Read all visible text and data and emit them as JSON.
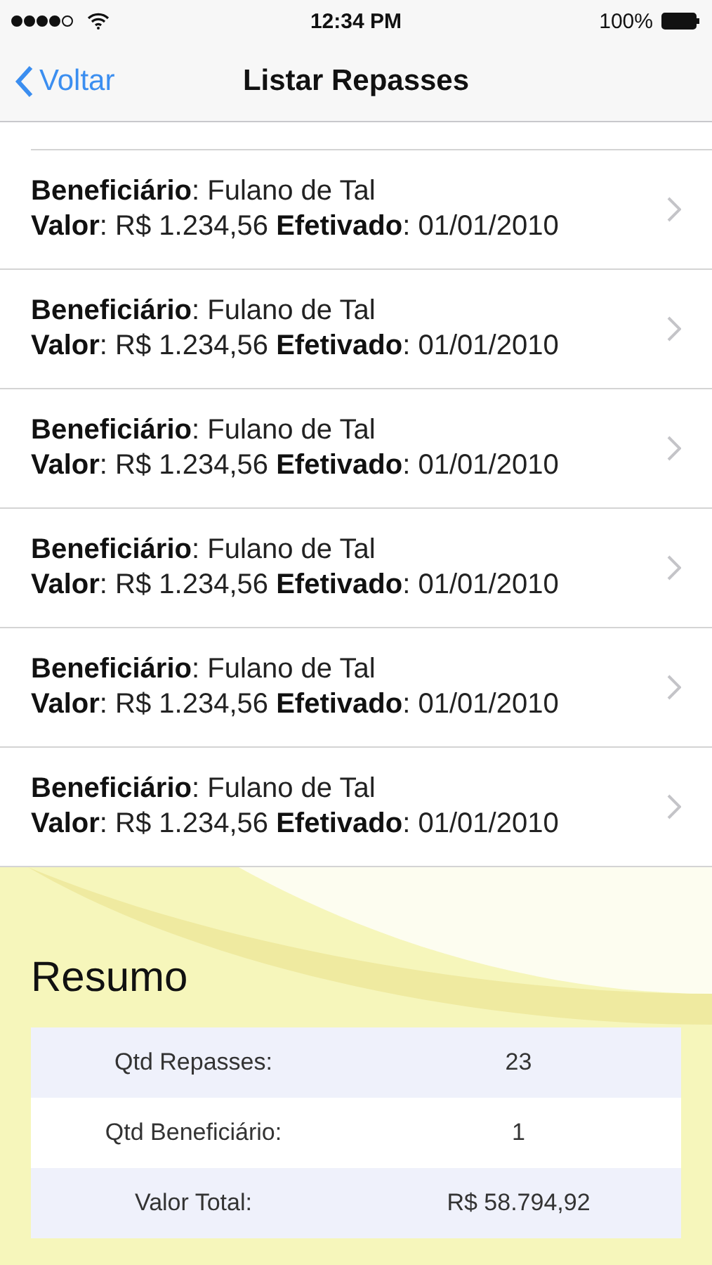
{
  "status_bar": {
    "time": "12:34 PM",
    "battery": "100%"
  },
  "nav": {
    "back": "Voltar",
    "title": "Listar Repasses"
  },
  "rows": [
    {
      "line_1": "**Beneficiário**: Fulano de Tal",
      "line_2": "**Valor**: R$ 1.234,56 **Efetivado**: 01/01/2010"
    },
    {
      "line_1": "**Beneficiário**: Fulano de Tal",
      "line_2": "**Valor**: R$ 1.234,56 **Efetivado**: 01/01/2010"
    },
    {
      "line_1": "**Beneficiário**: Fulano de Tal",
      "line_2": "**Valor**: R$ 1.234,56 **Efetivado**: 01/01/2010"
    },
    {
      "line_1": "**Beneficiário**: Fulano de Tal",
      "line_2": "**Valor**: R$ 1.234,56 **Efetivado**: 01/01/2010"
    },
    {
      "line_1": "**Beneficiário**: Fulano de Tal",
      "line_2": "**Valor**: R$ 1.234,56 **Efetivado**: 01/01/2010"
    },
    {
      "line_1": "**Beneficiário**: Fulano de Tal",
      "line_2": "**Valor**: R$ 1.234,56 **Efetivado**: 01/01/2010"
    }
  ],
  "summary": {
    "title": "Resumo",
    "rows": [
      {
        "label": "Qtd Repasses:",
        "value": "23"
      },
      {
        "label": "Qtd Beneficiário:",
        "value": "1"
      },
      {
        "label": "Valor Total:",
        "value": "R$ 58.794,92"
      }
    ]
  }
}
